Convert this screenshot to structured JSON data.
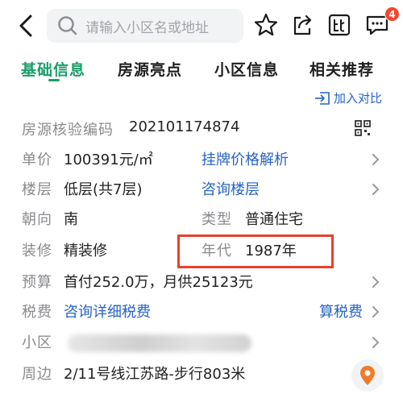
{
  "search": {
    "placeholder": "请输入小区名或地址"
  },
  "notifications": {
    "count": "4"
  },
  "tabs": [
    {
      "label": "基础信息",
      "active": true
    },
    {
      "label": "房源亮点"
    },
    {
      "label": "小区信息"
    },
    {
      "label": "相关推荐"
    }
  ],
  "compare_label": "加入对比",
  "rows": {
    "verify": {
      "label": "房源核验编码",
      "value": "202101174874"
    },
    "price": {
      "label": "单价",
      "value": "100391元/㎡",
      "link": "挂牌价格解析"
    },
    "floor": {
      "label": "楼层",
      "value": "低层(共7层)",
      "link": "咨询楼层"
    },
    "facing": {
      "label": "朝向",
      "value": "南",
      "label2": "类型",
      "value2": "普通住宅"
    },
    "decor": {
      "label": "装修",
      "value": "精装修",
      "label2": "年代",
      "value2": "1987年"
    },
    "budget": {
      "label": "预算",
      "value": "首付252.0万，月供25123元"
    },
    "tax": {
      "label": "税费",
      "link": "咨询详细税费",
      "link2": "算税费"
    },
    "community": {
      "label": "小区"
    },
    "nearby": {
      "label": "周边",
      "value": "2/11号线江苏路-步行803米"
    }
  },
  "colors": {
    "accent": "#1b9d68",
    "link": "#2763c7",
    "highlight": "#e8402b",
    "badge": "#f5442d"
  },
  "icons": [
    "back-icon",
    "search-icon",
    "star-icon",
    "share-icon",
    "compare-icon",
    "message-icon",
    "qr-code-icon",
    "chevron-right-icon",
    "location-pin-icon",
    "add-compare-icon"
  ]
}
